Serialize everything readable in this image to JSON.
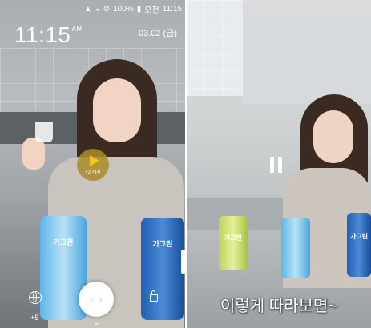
{
  "lockscreen": {
    "status_bar": {
      "battery": "100%",
      "ampm": "오전",
      "time": "11:15"
    },
    "clock": {
      "time": "11:15",
      "ampm": "AM"
    },
    "date": "03.02 (금)",
    "ad_button_label": "+2 캐시",
    "cash_badge": "+5",
    "product_labels": [
      "가그린",
      "가그린"
    ]
  },
  "video": {
    "caption": "이렇게 따라보면~",
    "product_labels": [
      "가그린",
      "가그린"
    ]
  },
  "icons": [
    "signal-icon",
    "wifi-icon",
    "no-sim-icon",
    "battery-icon",
    "play-icon",
    "globe-icon",
    "lock-icon",
    "chevron-down-icon",
    "pause-icon"
  ]
}
